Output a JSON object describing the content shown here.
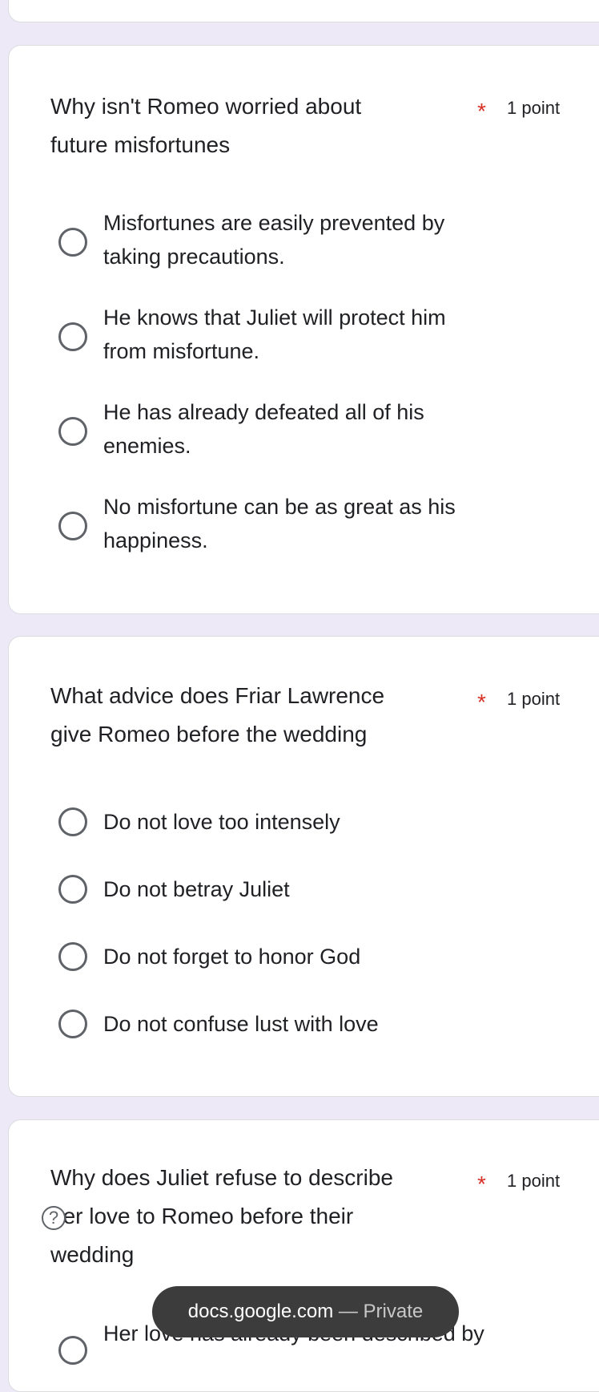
{
  "questions": [
    {
      "lines": [
        "Why isn't Romeo worried about",
        "future misfortunes"
      ],
      "required": "*",
      "points": "1 point",
      "options": [
        {
          "lines": [
            "Misfortunes are easily prevented by",
            "taking precautions."
          ]
        },
        {
          "lines": [
            "He knows that Juliet will protect him",
            "from misfortune."
          ]
        },
        {
          "lines": [
            "He has already defeated all of his",
            "enemies."
          ]
        },
        {
          "lines": [
            "No misfortune can be as great as his",
            "happiness."
          ]
        }
      ]
    },
    {
      "lines": [
        "What advice does Friar Lawrence",
        "give Romeo before the wedding"
      ],
      "required": "*",
      "points": "1 point",
      "options": [
        {
          "lines": [
            "Do not love too intensely"
          ]
        },
        {
          "lines": [
            "Do not betray Juliet"
          ]
        },
        {
          "lines": [
            "Do not forget to honor God"
          ]
        },
        {
          "lines": [
            "Do not confuse lust with love"
          ]
        }
      ]
    },
    {
      "lines": [
        "Why does Juliet refuse to describe",
        "her love to Romeo before their",
        "wedding"
      ],
      "required": "*",
      "points": "1 point",
      "options": [
        {
          "lines": [
            "Her love has already been described by"
          ]
        }
      ]
    }
  ],
  "help_icon": {
    "glyph": "?",
    "icon": "help-circle-icon"
  },
  "url_bar": {
    "domain": "docs.google.com",
    "separator": "—",
    "label": "Private"
  }
}
